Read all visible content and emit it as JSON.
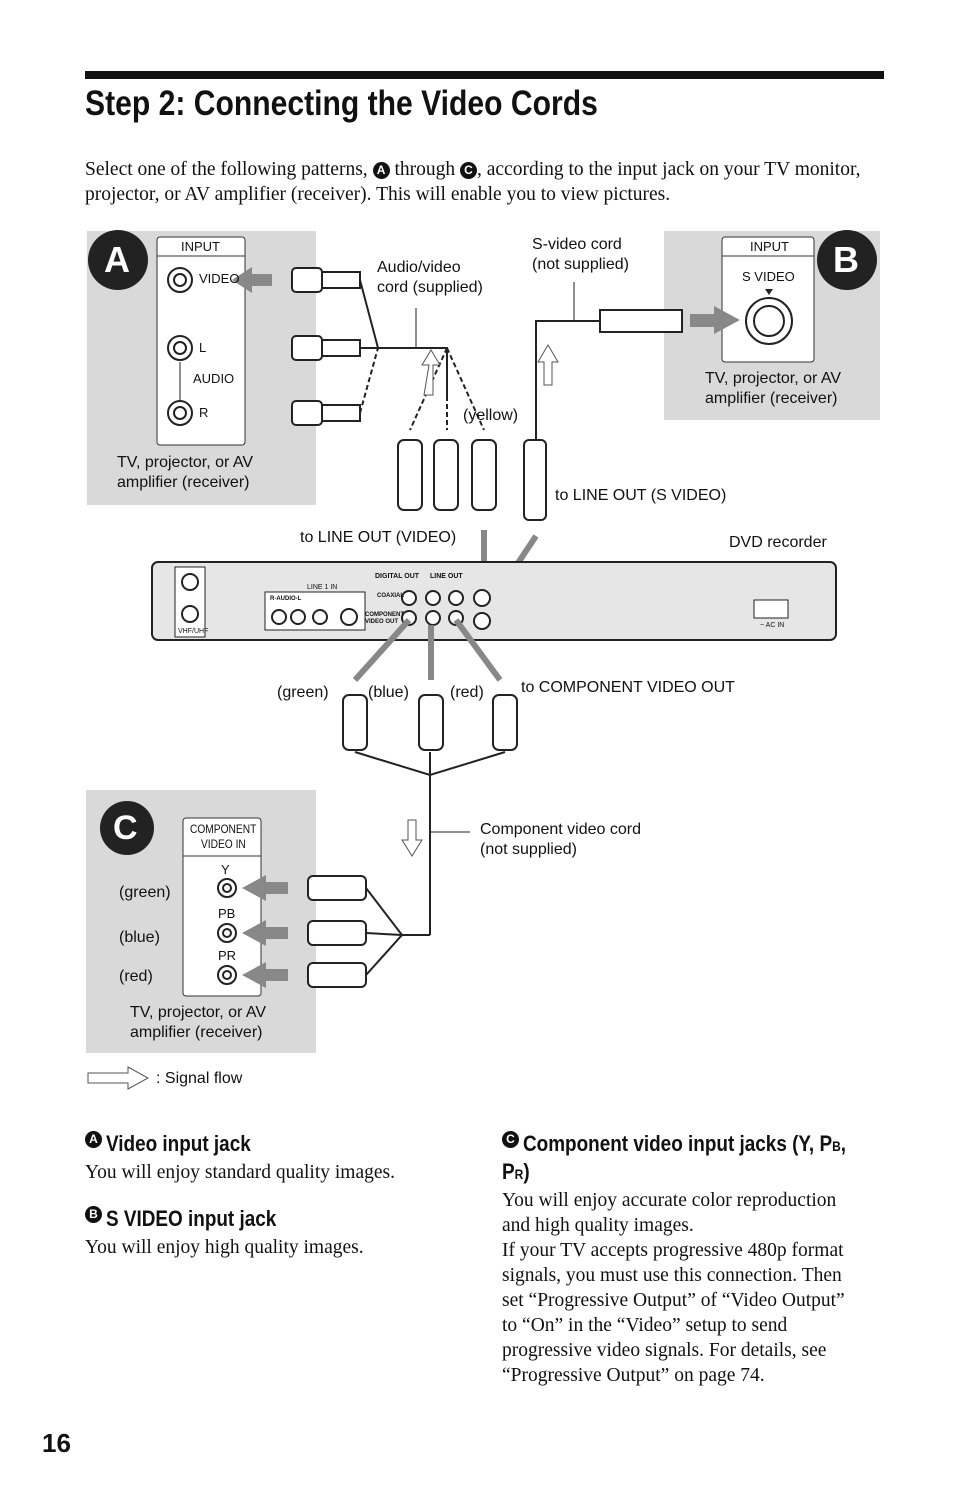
{
  "title": "Step 2: Connecting the Video Cords",
  "intro": {
    "before": "Select one of the following patterns, ",
    "badge_a": "A",
    "through": " through ",
    "badge_c": "C",
    "after": ", according to the input jack on your TV monitor, projector, or AV amplifier (receiver). This will enable you to view pictures."
  },
  "diagram": {
    "panel_a": {
      "badge": "A",
      "input": "INPUT",
      "video": "VIDEO",
      "l": "L",
      "audio": "AUDIO",
      "r": "R",
      "device": [
        "TV, projector, or AV",
        "amplifier (receiver)"
      ]
    },
    "panel_b": {
      "badge": "B",
      "input": "INPUT",
      "svideo": "S VIDEO",
      "device": [
        "TV, projector, or AV",
        "amplifier (receiver)"
      ]
    },
    "panel_c": {
      "badge": "C",
      "component": [
        "COMPONENT",
        "VIDEO IN"
      ],
      "y": "Y",
      "pb": "PB",
      "pr": "PR",
      "green": "(green)",
      "blue": "(blue)",
      "red": "(red)",
      "device": [
        "TV, projector, or AV",
        "amplifier (receiver)"
      ]
    },
    "av_cord": [
      "Audio/video",
      "cord (supplied)"
    ],
    "svideo_cord": [
      "S-video cord",
      "(not supplied)"
    ],
    "yellow": "(yellow)",
    "to_line_out_video": "to LINE OUT (VIDEO)",
    "to_line_out_svideo": "to LINE OUT (S VIDEO)",
    "dvd_recorder": "DVD recorder",
    "plug_green": "(green)",
    "plug_blue": "(blue)",
    "plug_red": "(red)",
    "to_component": "to COMPONENT VIDEO OUT",
    "component_cord": [
      "Component video cord",
      "(not supplied)"
    ],
    "signal_flow": ": Signal flow",
    "recorder_labels": {
      "vhf": "VHF/UHF",
      "in": "IN",
      "out": "OUT",
      "line1": "LINE 1 IN",
      "raudiol": "R-AUDIO-L",
      "video": "VIDEO",
      "svideo": "S VIDEO",
      "digital_out": "DIGITAL OUT",
      "coaxial": "COAXIAL",
      "line_out": "LINE OUT",
      "comp_out": [
        "COMPONENT",
        "VIDEO OUT"
      ],
      "acin": "~ AC IN"
    }
  },
  "sections": [
    {
      "badge": "A",
      "heading": "Video input jack",
      "body": [
        "You will enjoy standard quality images."
      ]
    },
    {
      "badge": "B",
      "heading": "S VIDEO input jack",
      "body": [
        "You will enjoy high quality images."
      ]
    },
    {
      "badge": "C",
      "heading": "Component video input jacks (Y, PB, PR)",
      "heading_lines": [
        "Component video input jacks (Y, P",
        "B",
        ",",
        "P",
        "R",
        ")"
      ],
      "body": [
        "You will enjoy accurate color reproduction",
        "and high quality images.",
        "If your TV accepts progressive 480p format",
        "signals, you must use this connection. Then",
        "set “Progressive Output” of “Video Output”",
        "to “On” in the “Video” setup to send",
        "progressive video signals. For details, see",
        "“Progressive Output” on page 74."
      ]
    }
  ],
  "page_number": "16"
}
